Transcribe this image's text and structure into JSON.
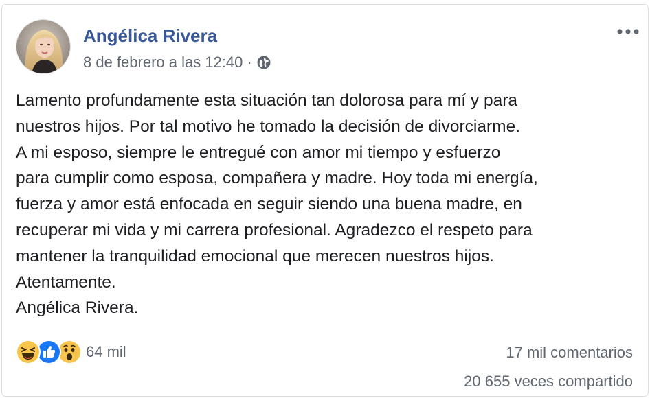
{
  "post": {
    "author": "Angélica Rivera",
    "timestamp": "8 de febrero a las 12:40",
    "separator": "·",
    "privacy_icon": "globe-icon",
    "more_icon": "more-options-icon",
    "avatar_icon": "profile-photo",
    "paragraphs": [
      "Lamento profundamente esta situación tan dolorosa para mí y para",
      "nuestros hijos. Por tal motivo he tomado la decisión de divorciarme.",
      "A mi esposo, siempre le entregué con amor mi tiempo y esfuerzo",
      "para cumplir como esposa, compañera y madre. Hoy toda mi energía,",
      "fuerza y amor está enfocada en seguir siendo una buena madre, en",
      "recuperar mi vida y mi carrera profesional. Agradezco el respeto para",
      "mantener la tranquilidad emocional que merecen nuestros hijos.",
      "Atentamente.",
      "Angélica Rivera."
    ]
  },
  "footer": {
    "reaction_icons": [
      "haha-icon",
      "like-icon",
      "wow-icon"
    ],
    "reaction_count": "64 mil",
    "comments": "17 mil comentarios",
    "shares": "20 655 veces compartido"
  },
  "colors": {
    "author": "#385898",
    "meta": "#606770",
    "text": "#1c1e21",
    "like_blue": "#1877f2",
    "reaction_yellow": "#f7c44c",
    "border": "#dddfe2"
  }
}
